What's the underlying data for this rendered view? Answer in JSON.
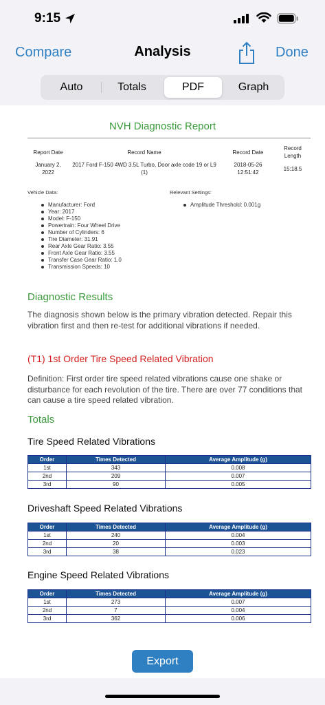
{
  "status_bar": {
    "time": "9:15"
  },
  "nav": {
    "compare": "Compare",
    "title": "Analysis",
    "done": "Done"
  },
  "tabs": [
    {
      "label": "Auto",
      "active": false
    },
    {
      "label": "Totals",
      "active": false
    },
    {
      "label": "PDF",
      "active": true
    },
    {
      "label": "Graph",
      "active": false
    }
  ],
  "report": {
    "title": "NVH Diagnostic Report",
    "headers": {
      "date": "Report Date",
      "name": "Record Name",
      "record_date": "Record Date",
      "length": "Record Length"
    },
    "values": {
      "date": "January 2, 2022",
      "name": "2017 Ford F-150 4WD 3.5L Turbo, Door axle code 19 or L9 (1)",
      "record_date": "2018-05-26 12:51:42",
      "length": "15:18.5"
    },
    "vehicle_label": "Vehicle Data:",
    "settings_label": "Relevant Settings:",
    "vehicle": [
      "Manufacturer: Ford",
      "Year: 2017",
      "Model: F-150",
      "Powertrain: Four Wheel Drive",
      "Number of Cylinders: 6",
      "Tire Diameter: 31.91",
      "Rear Axle Gear Ratio: 3.55",
      "Front Axle Gear Ratio: 3.55",
      "Transfer Case Gear Ratio: 1.0",
      "Transmission Speeds: 10"
    ],
    "settings": [
      "Amplitude Threshold: 0.001g"
    ],
    "diagnostic_title": "Diagnostic Results",
    "diagnostic_text": "The diagnosis shown below is the primary vibration detected. Repair this vibration first and then re-test for additional vibrations if needed.",
    "primary_title": "(T1) 1st Order Tire Speed Related Vibration",
    "definition": "Definition: First order tire speed related vibrations cause one shake or disturbance for each revolution of the tire. There are over 77 conditions that can cause a tire speed related vibration.",
    "totals_title": "Totals",
    "table_headers": [
      "Order",
      "Times Detected",
      "Average Amplitude (g)"
    ],
    "tables": [
      {
        "title": "Tire Speed Related Vibrations",
        "rows": [
          [
            "1st",
            "343",
            "0.008"
          ],
          [
            "2nd",
            "209",
            "0.007"
          ],
          [
            "3rd",
            "90",
            "0.005"
          ]
        ]
      },
      {
        "title": "Driveshaft Speed Related Vibrations",
        "rows": [
          [
            "1st",
            "240",
            "0.004"
          ],
          [
            "2nd",
            "20",
            "0.003"
          ],
          [
            "3rd",
            "38",
            "0.023"
          ]
        ]
      },
      {
        "title": "Engine Speed Related Vibrations",
        "rows": [
          [
            "1st",
            "273",
            "0.007"
          ],
          [
            "2nd",
            "7",
            "0.004"
          ],
          [
            "3rd",
            "362",
            "0.006"
          ]
        ]
      }
    ]
  },
  "export_label": "Export",
  "colors": {
    "accent": "#2f80c2",
    "green": "#3b9a3b",
    "red": "#d42020",
    "table_header": "#1c5394"
  }
}
